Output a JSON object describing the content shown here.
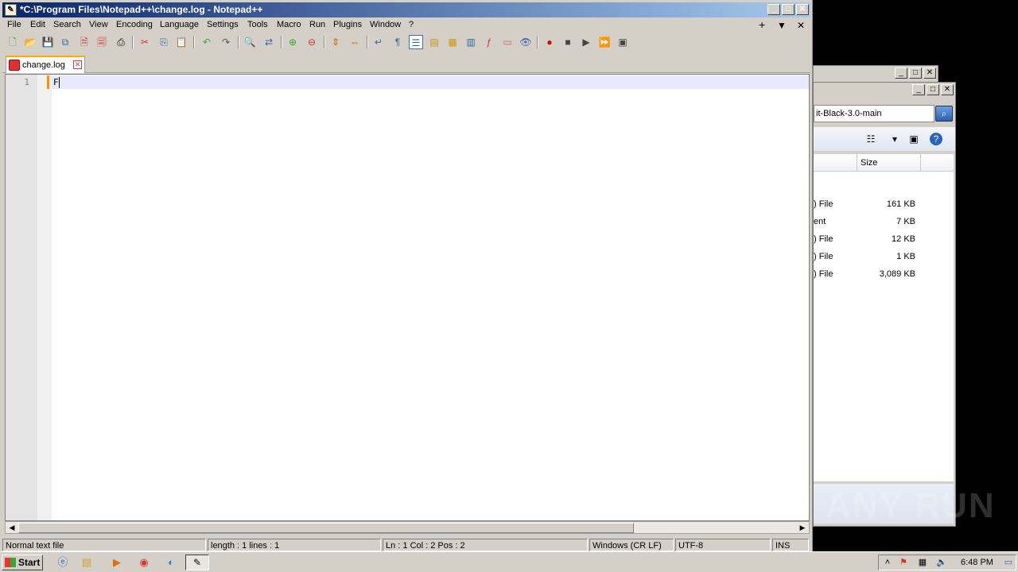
{
  "notepad": {
    "title": "*C:\\Program Files\\Notepad++\\change.log - Notepad++",
    "menu": [
      "File",
      "Edit",
      "Search",
      "View",
      "Encoding",
      "Language",
      "Settings",
      "Tools",
      "Macro",
      "Run",
      "Plugins",
      "Window",
      "?"
    ],
    "menu_right": {
      "add": "+",
      "dropdown": "▼",
      "close": "✕"
    },
    "tab": {
      "label": "change.log"
    },
    "editor": {
      "line_number": "1",
      "content": "F"
    },
    "status": {
      "file_type": "Normal text file",
      "length_lines": "length : 1    lines : 1",
      "position": "Ln : 1    Col : 2    Pos : 2",
      "eol": "Windows (CR LF)",
      "encoding": "UTF-8",
      "mode": "INS"
    }
  },
  "explorer": {
    "address": "it-Black-3.0-main",
    "columns": [
      "Size"
    ],
    "rows": [
      {
        "type": ") File",
        "size": "161 KB"
      },
      {
        "type": "ent",
        "size": "7 KB"
      },
      {
        "type": ") File",
        "size": "12 KB"
      },
      {
        "type": ") File",
        "size": "1 KB"
      },
      {
        "type": ") File",
        "size": "3,089 KB"
      }
    ]
  },
  "taskbar": {
    "start_label": "Start",
    "clock": "6:48 PM"
  },
  "watermark": "ANY RUN"
}
